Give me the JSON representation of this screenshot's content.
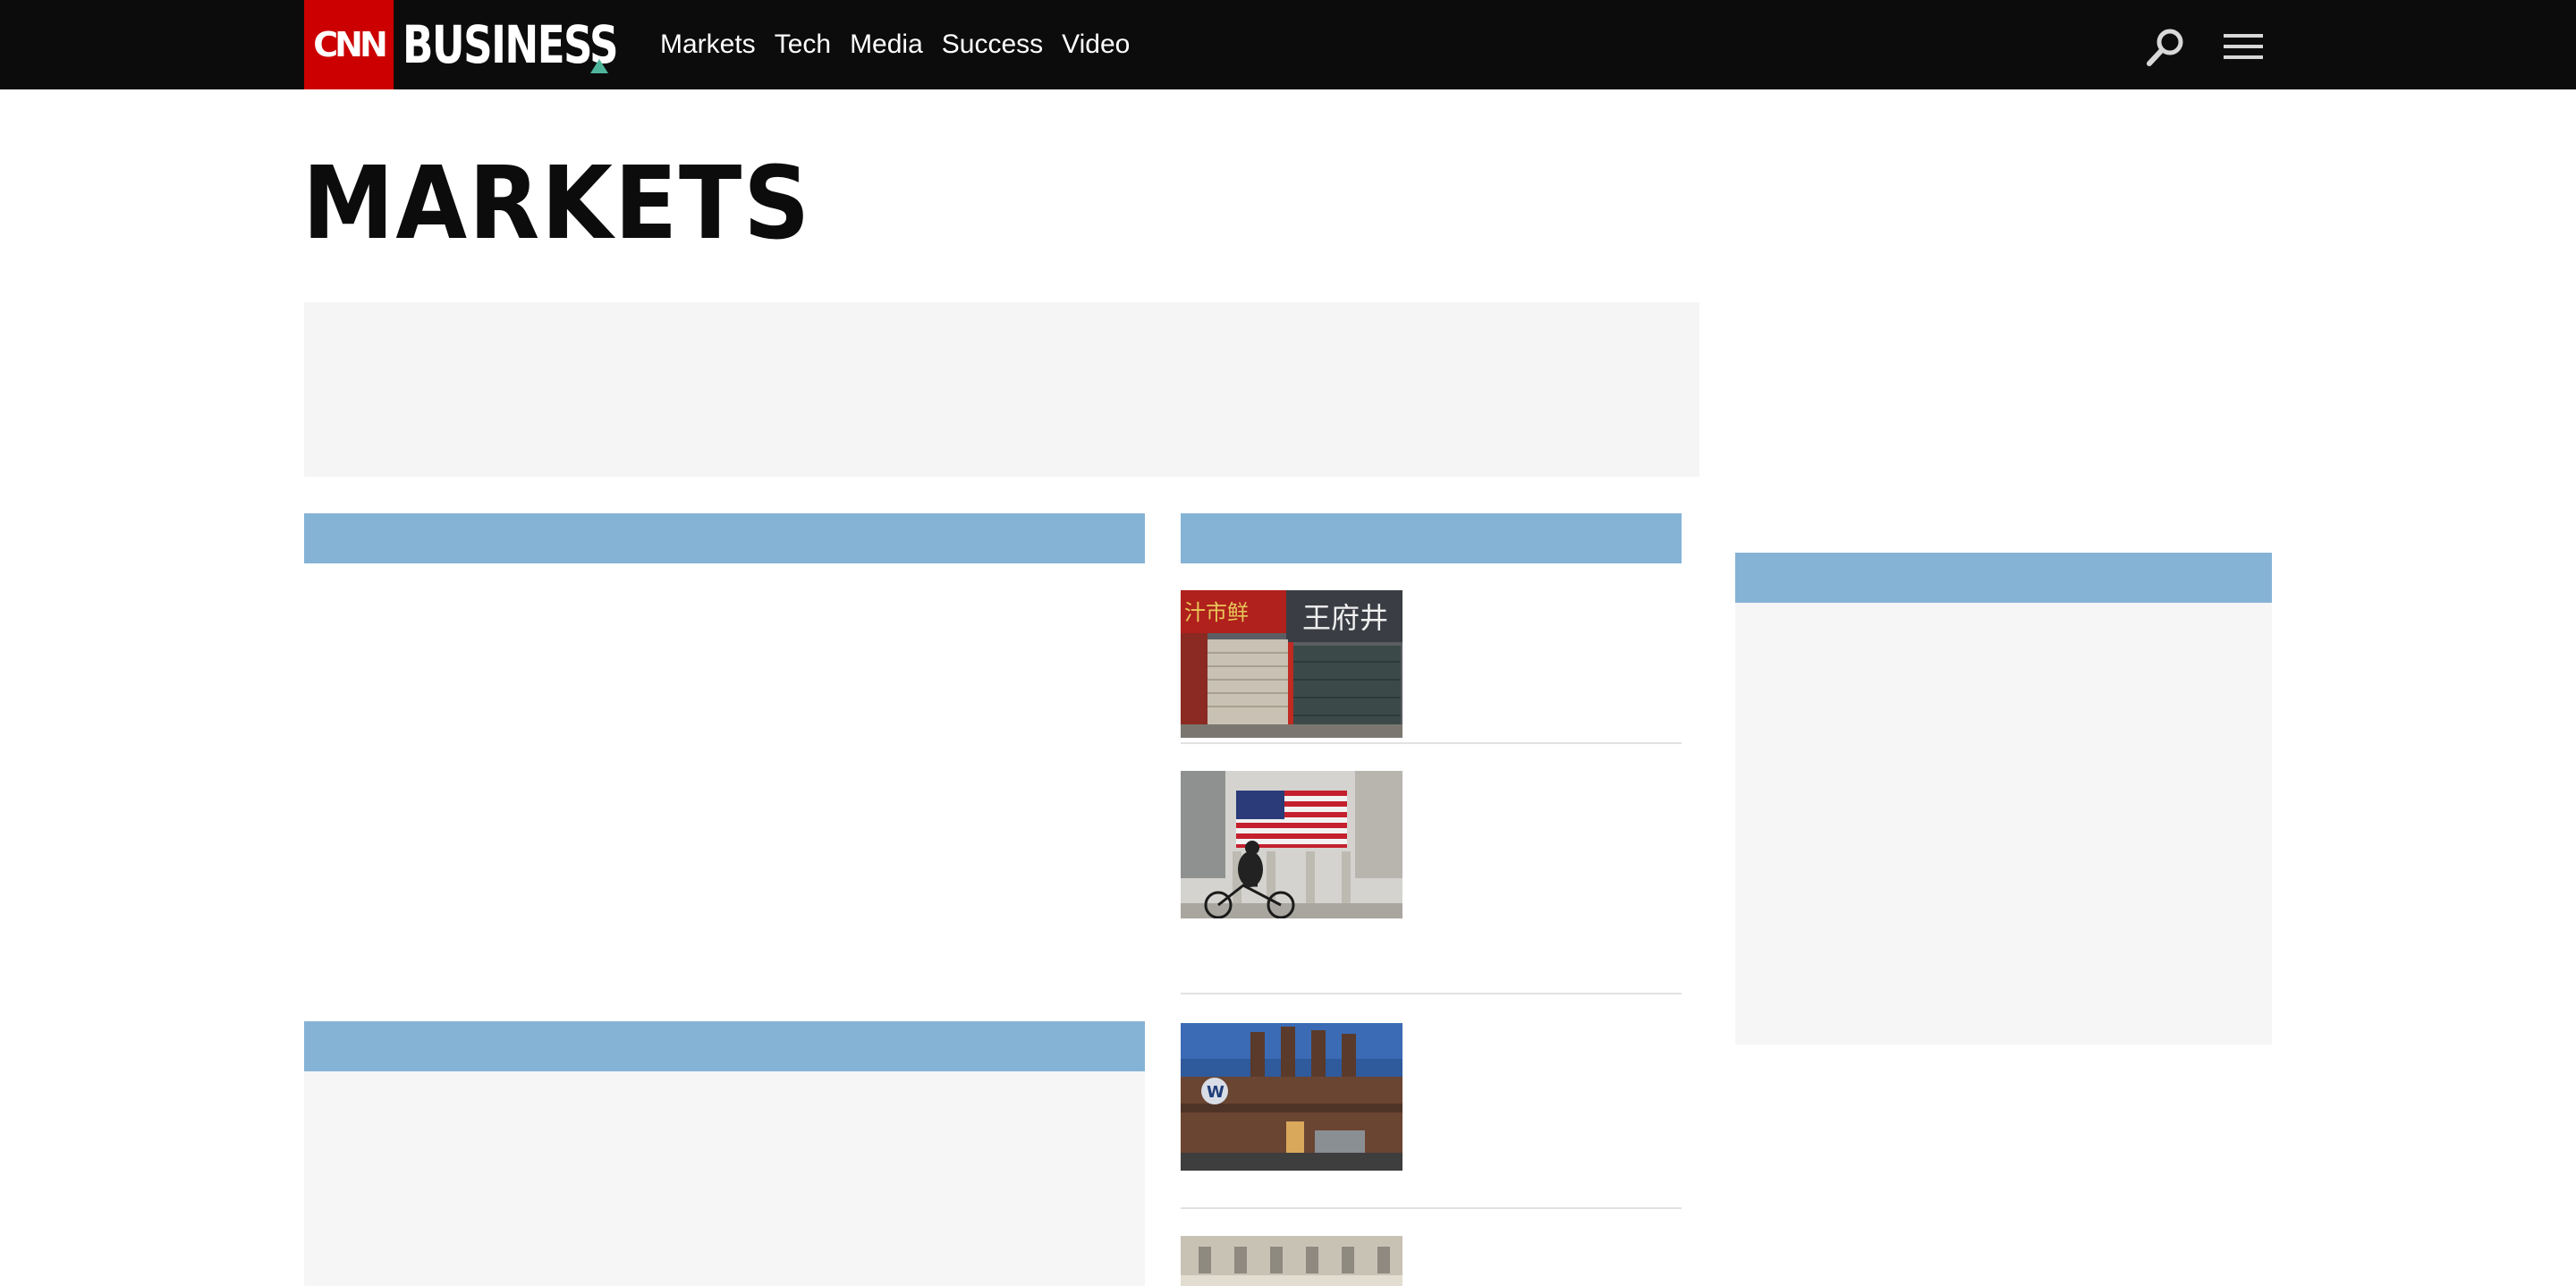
{
  "header": {
    "logo_mark": "CNN",
    "logo_text": "BUSINESS",
    "nav": [
      "Markets",
      "Tech",
      "Media",
      "Success",
      "Video"
    ],
    "search_icon": "search-icon",
    "menu_icon": "hamburger-menu-icon"
  },
  "page": {
    "title": "MARKETS"
  },
  "thumbs": [
    {
      "name": "beijing-storefront-thumbnail",
      "sign_text": "王府井"
    },
    {
      "name": "nyse-flag-cyclist-thumbnail"
    },
    {
      "name": "volkswagen-factory-thumbnail"
    },
    {
      "name": "building-facade-thumbnail"
    }
  ],
  "colors": {
    "topbar": "#0c0c0c",
    "logo_red": "#cc0000",
    "section_bar": "#85b3d6",
    "placeholder": "#f5f5f5"
  }
}
